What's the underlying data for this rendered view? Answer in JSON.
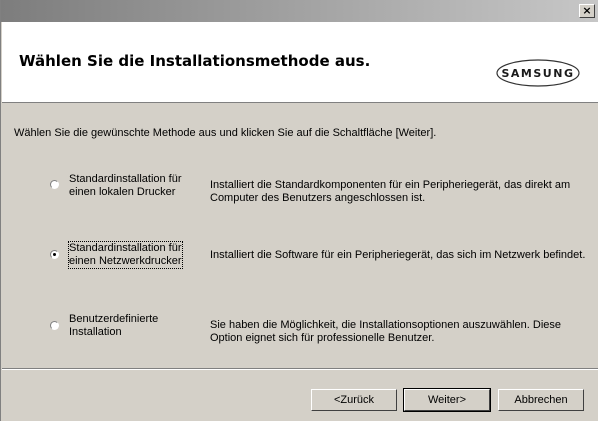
{
  "window": {
    "close_label": "×"
  },
  "header": {
    "title": "Wählen Sie die Installationsmethode aus.",
    "logo_text": "SAMSUNG"
  },
  "main": {
    "instruction": "Wählen Sie die gewünschte Methode aus und klicken Sie auf die Schaltfläche [Weiter].",
    "options": [
      {
        "label": "Standardinstallation für\neinen lokalen Drucker",
        "description": "Installiert die Standardkomponenten für ein Peripheriegerät, das direkt am Computer des Benutzers angeschlossen ist.",
        "selected": false
      },
      {
        "label": "Standardinstallation für\neinen Netzwerkdrucker",
        "description": "Installiert die Software für ein Peripheriegerät, das sich im Netzwerk befindet.",
        "selected": true
      },
      {
        "label": "Benutzerdefinierte\nInstallation",
        "description": "Sie haben die Möglichkeit, die Installationsoptionen auszuwählen. Diese Option eignet sich für professionelle Benutzer.",
        "selected": false
      }
    ]
  },
  "footer": {
    "back_label": "<Zurück",
    "next_label": "Weiter>",
    "cancel_label": "Abbrechen"
  },
  "colors": {
    "dialog_bg": "#d4d0c8",
    "header_bg": "#ffffff",
    "logo_text": "#1a1a1a"
  }
}
